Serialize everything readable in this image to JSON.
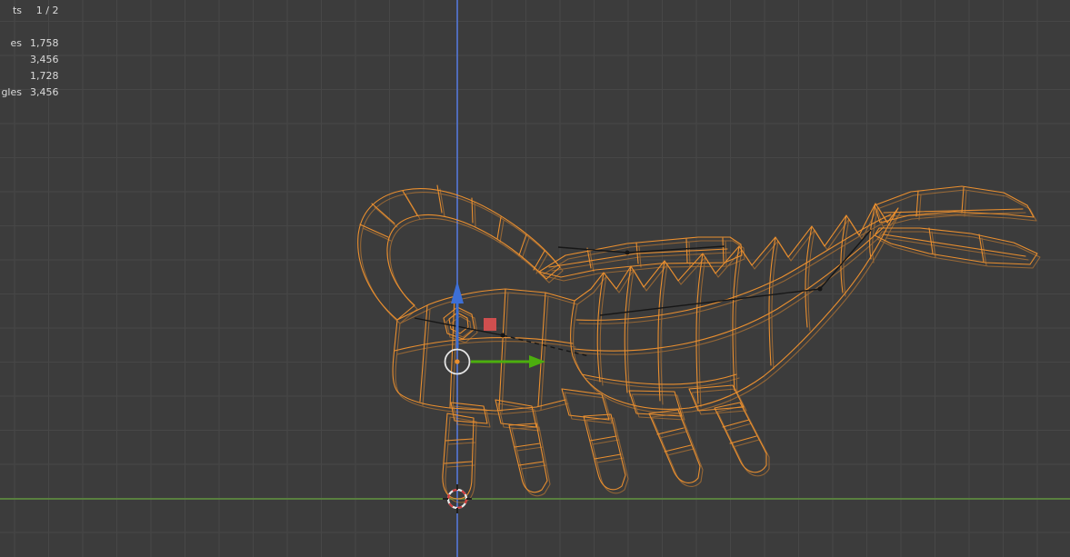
{
  "viewport": {
    "stats": {
      "rows": [
        {
          "label": "ts",
          "value": "1 / 2"
        },
        {
          "label": "es",
          "value": "1,758"
        },
        {
          "label": "",
          "value": "3,456"
        },
        {
          "label": "",
          "value": "1,728"
        },
        {
          "label": "gles",
          "value": "3,456"
        }
      ]
    }
  },
  "colors": {
    "background": "#3c3c3c",
    "grid": "#474747",
    "axis_z": "#5273cf",
    "axis_y": "#5e8f3d",
    "wireframe": "#ea8f2f",
    "armature_dark": "#161616",
    "gizmo_ring": "#e5e5e5",
    "gizmo_green": "#4cae0e",
    "gizmo_blue": "#3d6fd6",
    "gizmo_red": "#cf4f4f",
    "cursor_red": "#d23c3c",
    "cursor_white": "#e8e8e8",
    "stats_text": "#dadada"
  }
}
